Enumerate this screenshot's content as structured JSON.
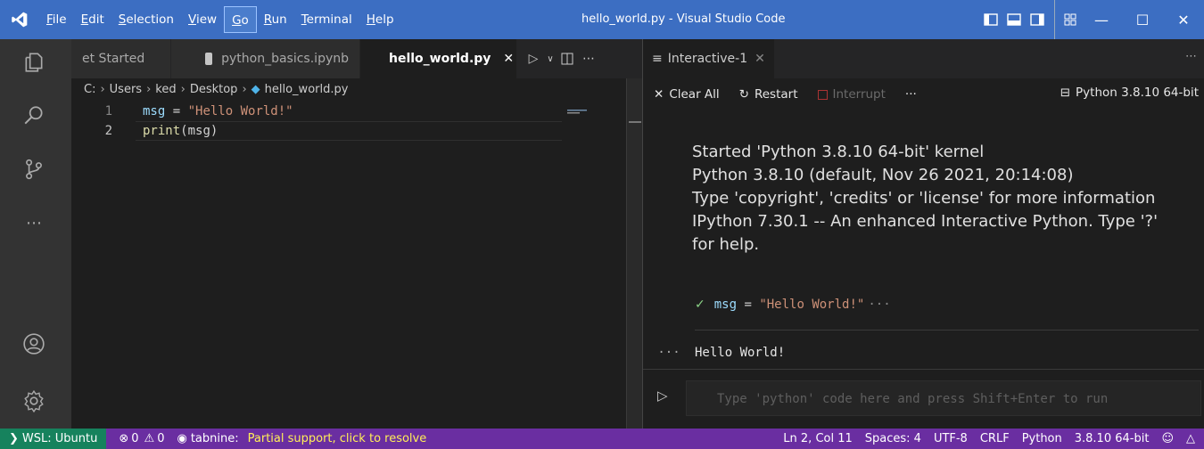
{
  "titlebar": {
    "menu": [
      "File",
      "Edit",
      "Selection",
      "View",
      "Go",
      "Run",
      "Terminal",
      "Help"
    ],
    "menu_underline": [
      "F",
      "E",
      "S",
      "V",
      "G",
      "R",
      "T",
      "H"
    ],
    "title": "hello_world.py - Visual Studio Code",
    "accent": "#3c6ec2"
  },
  "tabs": [
    {
      "label": "et Started",
      "icon": "",
      "active": false
    },
    {
      "label": "python_basics.ipynb",
      "icon": "notebook-icon",
      "active": false
    },
    {
      "label": "hello_world.py",
      "icon": "python-icon",
      "active": true
    }
  ],
  "breadcrumb": [
    "C:",
    "Users",
    "ked",
    "Desktop",
    "hello_world.py"
  ],
  "code": {
    "lines": [
      {
        "num": "1",
        "var": "msg",
        "op": " = ",
        "str": "\"Hello World!\""
      },
      {
        "num": "2",
        "fn": "print",
        "rest": "(msg)"
      }
    ]
  },
  "interactive": {
    "tab_label": "Interactive-1",
    "toolbar": {
      "clear_all": "Clear All",
      "restart": "Restart",
      "interrupt": "Interrupt",
      "more": "···"
    },
    "kernel": "Python 3.8.10 64-bit",
    "output": [
      "Started 'Python 3.8.10 64-bit' kernel",
      "Python 3.8.10 (default, Nov 26 2021, 20:14:08)",
      "Type 'copyright', 'credits' or 'license' for more information",
      "IPython 7.30.1 -- An enhanced Interactive Python. Type '?'",
      "for help."
    ],
    "cell_var": "msg",
    "cell_op": " = ",
    "cell_str": "\"Hello World!\"",
    "cell_more": "···",
    "result_dots": "···",
    "result": "Hello World!",
    "input_placeholder": "Type 'python' code here and press Shift+Enter to run"
  },
  "statusbar": {
    "remote": "WSL: Ubuntu",
    "errors": "0",
    "warnings": "0",
    "tabnine": "tabnine:",
    "tabnine_msg": "Partial support, click to resolve",
    "position": "Ln 2, Col 11",
    "spaces": "Spaces: 4",
    "encoding": "UTF-8",
    "eol": "CRLF",
    "language": "Python",
    "interpreter": "3.8.10 64-bit",
    "color_bg": "#6a2ea1",
    "color_remote": "#16825d"
  }
}
